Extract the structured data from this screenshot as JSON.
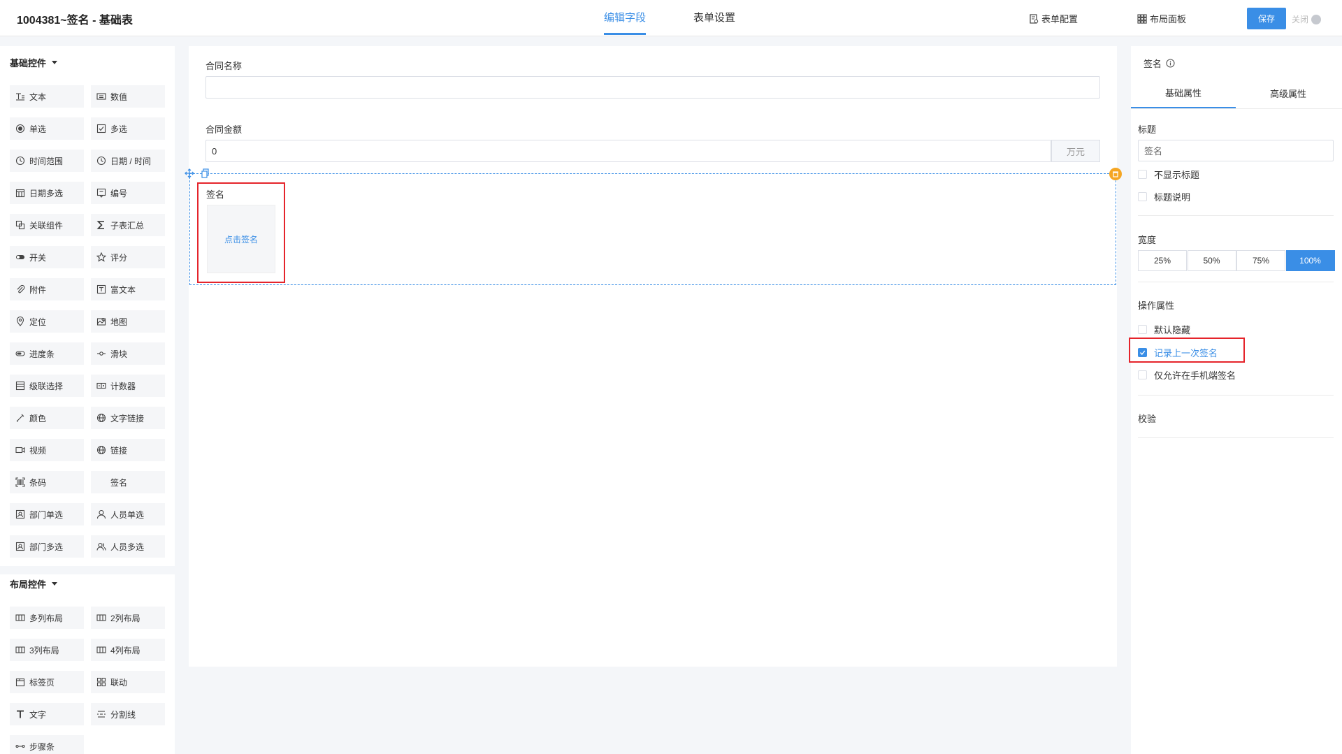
{
  "header": {
    "title": "1004381~签名 - 基础表",
    "tabs": [
      {
        "label": "编辑字段",
        "active": true
      },
      {
        "label": "表单设置",
        "active": false
      }
    ],
    "form_config": "表单配置",
    "layout_panel": "布局面板",
    "save": "保存",
    "close": "关闭"
  },
  "left": {
    "basic_title": "基础控件",
    "basic_controls": [
      {
        "label": "文本",
        "icon": "text-icon"
      },
      {
        "label": "数值",
        "icon": "number-icon"
      },
      {
        "label": "单选",
        "icon": "radio-icon"
      },
      {
        "label": "多选",
        "icon": "checkbox-icon"
      },
      {
        "label": "时间范围",
        "icon": "clock-icon"
      },
      {
        "label": "日期 / 时间",
        "icon": "clock-icon"
      },
      {
        "label": "日期多选",
        "icon": "calendar-icon"
      },
      {
        "label": "编号",
        "icon": "serial-icon"
      },
      {
        "label": "关联组件",
        "icon": "link-copy-icon"
      },
      {
        "label": "子表汇总",
        "icon": "sigma-icon"
      },
      {
        "label": "开关",
        "icon": "toggle-icon"
      },
      {
        "label": "评分",
        "icon": "star-icon"
      },
      {
        "label": "附件",
        "icon": "paperclip-icon"
      },
      {
        "label": "富文本",
        "icon": "richtext-icon"
      },
      {
        "label": "定位",
        "icon": "location-icon"
      },
      {
        "label": "地图",
        "icon": "map-icon"
      },
      {
        "label": "进度条",
        "icon": "progress-icon"
      },
      {
        "label": "滑块",
        "icon": "slider-icon"
      },
      {
        "label": "级联选择",
        "icon": "cascade-icon"
      },
      {
        "label": "计数器",
        "icon": "counter-icon"
      },
      {
        "label": "颜色",
        "icon": "pen-icon"
      },
      {
        "label": "文字链接",
        "icon": "globe-icon"
      },
      {
        "label": "视频",
        "icon": "video-icon"
      },
      {
        "label": "链接",
        "icon": "globe-icon"
      },
      {
        "label": "条码",
        "icon": "barcode-icon"
      },
      {
        "label": "签名",
        "icon": ""
      },
      {
        "label": "部门单选",
        "icon": "dept-icon"
      },
      {
        "label": "人员单选",
        "icon": "user-icon"
      },
      {
        "label": "部门多选",
        "icon": "dept-icon"
      },
      {
        "label": "人员多选",
        "icon": "users-icon"
      }
    ],
    "layout_title": "布局控件",
    "layout_controls": [
      {
        "label": "多列布局",
        "icon": "columns-icon"
      },
      {
        "label": "2列布局",
        "icon": "columns-icon"
      },
      {
        "label": "3列布局",
        "icon": "columns-icon"
      },
      {
        "label": "4列布局",
        "icon": "columns-icon"
      },
      {
        "label": "标签页",
        "icon": "tabs-icon"
      },
      {
        "label": "联动",
        "icon": "grid-icon"
      },
      {
        "label": "文字",
        "icon": "T-icon"
      },
      {
        "label": "分割线",
        "icon": "divider-icon"
      },
      {
        "label": "步骤条",
        "icon": "steps-icon"
      }
    ]
  },
  "canvas": {
    "contract_name_label": "合同名称",
    "contract_name_value": "",
    "contract_amount_label": "合同金额",
    "contract_amount_value": "0",
    "amount_unit": "万元",
    "signature_label": "签名",
    "signature_placeholder": "点击签名"
  },
  "right": {
    "title": "签名",
    "tabs": [
      {
        "label": "基础属性",
        "active": true
      },
      {
        "label": "高级属性",
        "active": false
      }
    ],
    "title_section": "标题",
    "title_value": "签名",
    "hide_title": "不显示标题",
    "title_desc": "标题说明",
    "width_section": "宽度",
    "width_options": [
      "25%",
      "50%",
      "75%",
      "100%"
    ],
    "width_selected": "100%",
    "operation_section": "操作属性",
    "default_hidden": "默认隐藏",
    "record_last": "记录上一次签名",
    "mobile_only": "仅允许在手机端签名",
    "validation_section": "校验",
    "accent_color": "#3a8ee6",
    "highlight_color": "#e5242b"
  }
}
